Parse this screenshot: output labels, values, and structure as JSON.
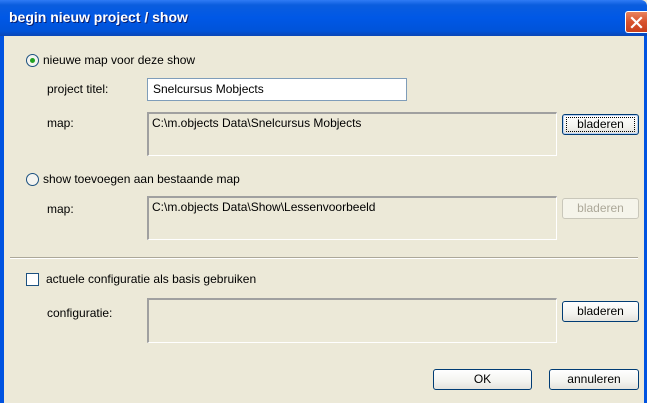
{
  "window": {
    "title": "begin nieuw project / show"
  },
  "options": {
    "new_folder": {
      "label": "nieuwe map voor deze show",
      "project_title_label": "project titel:",
      "project_title_value": "Snelcursus Mobjects",
      "folder_label": "map:",
      "folder_value": "C:\\m.objects Data\\Snelcursus Mobjects",
      "browse_label": "bladeren"
    },
    "existing_folder": {
      "label": "show toevoegen aan bestaande map",
      "folder_label": "map:",
      "folder_value": "C:\\m.objects Data\\Show\\Lessenvoorbeeld",
      "browse_label": "bladeren"
    },
    "configuration": {
      "label": "actuele configuratie als basis gebruiken",
      "config_label": "configuratie:",
      "config_value": "",
      "browse_label": "bladeren"
    }
  },
  "buttons": {
    "ok": "OK",
    "cancel": "annuleren"
  }
}
